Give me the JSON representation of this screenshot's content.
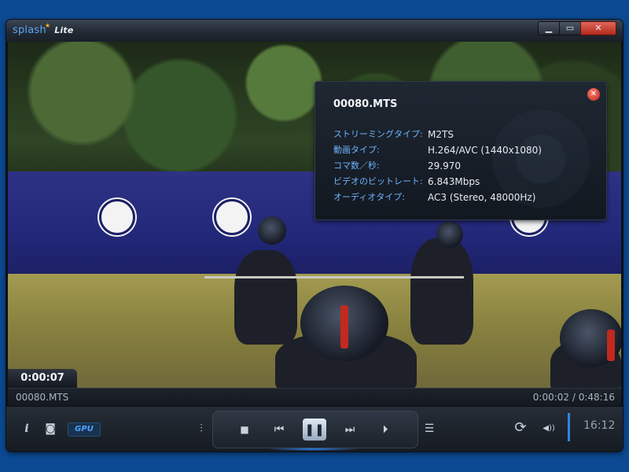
{
  "titlebar": {
    "logo_main": "splash",
    "logo_sub": "Lite",
    "min_glyph": "▁",
    "max_glyph": "▭",
    "close_glyph": "✕"
  },
  "video": {
    "timecode": "0:00:07"
  },
  "info_panel": {
    "filename": "00080.MTS",
    "close_glyph": "✕",
    "rows": [
      {
        "label": "ストリーミングタイプ:",
        "value": "M2TS"
      },
      {
        "label": "動画タイプ:",
        "value": "H.264/AVC (1440x1080)"
      },
      {
        "label": "コマ数／秒:",
        "value": "29.970"
      },
      {
        "label": "ビデオのビットレート:",
        "value": "6.843Mbps"
      },
      {
        "label": "オーディオタイプ:",
        "value": "AC3 (Stereo, 48000Hz)"
      }
    ]
  },
  "statusbar": {
    "filename": "00080.MTS",
    "time": "0:00:02 / 0:48:16"
  },
  "controls": {
    "info_glyph": "i",
    "snapshot_glyph": "◙",
    "gpu_label": "GPU",
    "equalizer_glyph": "⫶",
    "stop_glyph": "■",
    "prev_glyph": "⏮",
    "pause_glyph": "❚❚",
    "next_glyph": "⏭",
    "play_glyph": "⏵",
    "playlist_glyph": "☰",
    "repeat_glyph": "⟳",
    "volume_glyph": "◀))",
    "clock": "16:12"
  },
  "colors": {
    "accent": "#2f83e6",
    "label_blue": "#6fb3ff",
    "close_red": "#c9372a"
  }
}
